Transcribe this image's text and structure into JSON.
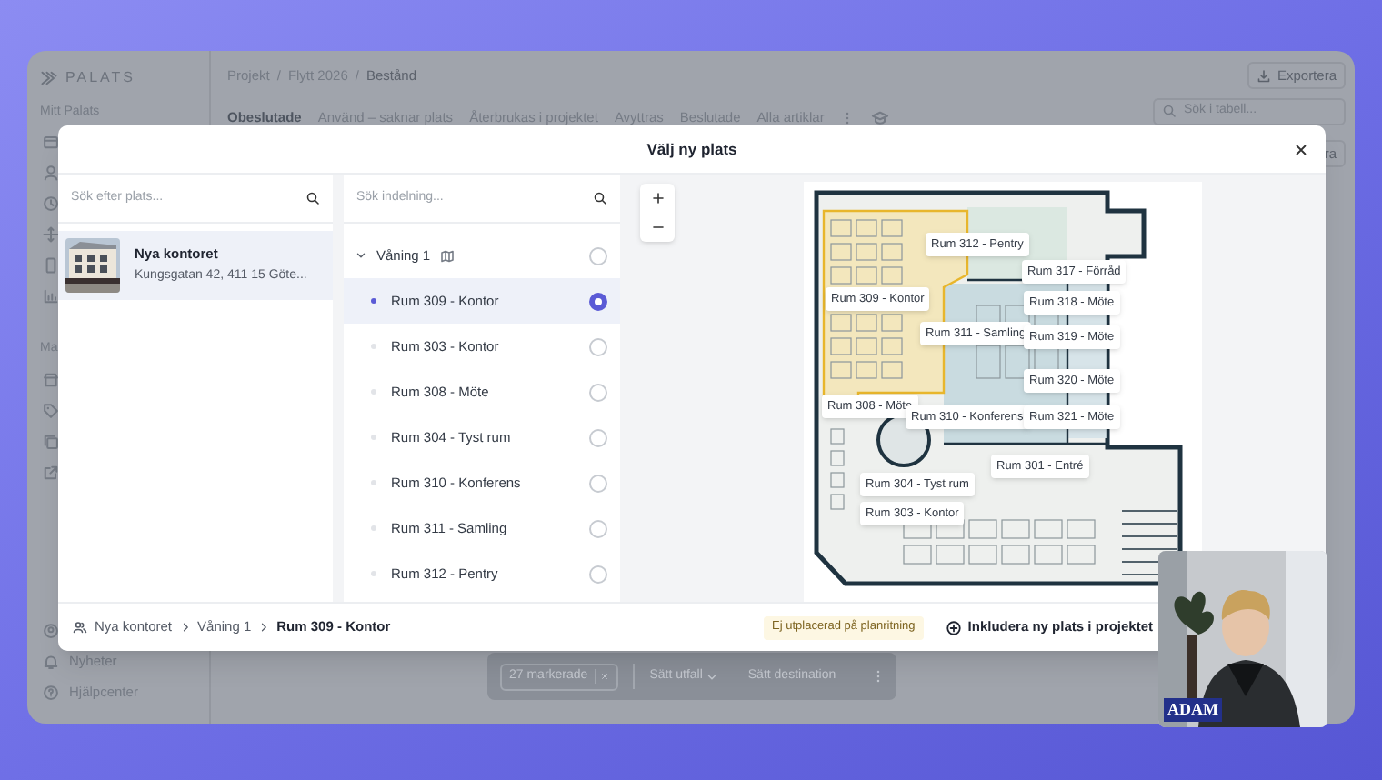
{
  "app": {
    "logo": "PALATS",
    "sidebar": {
      "top_label": "Mitt Palats",
      "section_label": "Ma",
      "footer_items": [
        "Nyheter",
        "Hjälpcenter"
      ]
    },
    "breadcrumb": [
      "Projekt",
      "Flytt 2026",
      "Bestånd"
    ],
    "breadcrumb_separators": [
      "/",
      "/"
    ],
    "export_button": "Exportera",
    "tabs": [
      {
        "label": "Obeslutade",
        "selected": true
      },
      {
        "label": "Använd – saknar plats",
        "selected": false
      },
      {
        "label": "Återbrukas i projektet",
        "selected": false
      },
      {
        "label": "Avyttras",
        "selected": false
      },
      {
        "label": "Beslutade",
        "selected": false
      },
      {
        "label": "Alla artiklar",
        "selected": false
      }
    ],
    "table_search": {
      "placeholder": "Sök i tabell..."
    },
    "partial_button": "ra",
    "action_bar": {
      "count": "27 markerade",
      "outcome_button": "Sätt utfall",
      "destination_button": "Sätt destination"
    }
  },
  "modal": {
    "title": "Välj ny plats",
    "location_search": {
      "placeholder": "Sök efter plats..."
    },
    "locations": [
      {
        "name": "Nya kontoret",
        "address": "Kungsgatan 42, 411 15 Göte...",
        "selected": true
      }
    ],
    "division_search": {
      "placeholder": "Sök indelning..."
    },
    "tree": [
      {
        "label": "Våning 1",
        "expanded": true,
        "selected": false,
        "children": [
          {
            "label": "Rum 309 - Kontor",
            "selected": true
          },
          {
            "label": "Rum 303 - Kontor",
            "selected": false
          },
          {
            "label": "Rum 308 - Möte",
            "selected": false
          },
          {
            "label": "Rum 304 - Tyst rum",
            "selected": false
          },
          {
            "label": "Rum 310 - Konferens",
            "selected": false
          },
          {
            "label": "Rum 311 - Samling",
            "selected": false
          },
          {
            "label": "Rum 312 - Pentry",
            "selected": false
          }
        ]
      }
    ],
    "map_rooms": [
      "Rum 312 - Pentry",
      "Rum 317 - Förråd",
      "Rum 309 - Kontor",
      "Rum 318 - Möte",
      "Rum 311 - Samling",
      "Rum 319 - Möte",
      "Rum 320 - Möte",
      "Rum 308 - Möte",
      "Rum 310 - Konferens",
      "Rum 321 - Möte",
      "Rum 301 - Entré",
      "Rum 304 - Tyst rum",
      "Rum 303 - Kontor"
    ],
    "footer": {
      "path": [
        "Nya kontoret",
        "Våning 1",
        "Rum 309 - Kontor"
      ],
      "badge": "Ej utplacerad på planritning",
      "include_button": "Inkludera ny plats i projektet"
    }
  },
  "video": {
    "name_tag": "ADAM"
  }
}
